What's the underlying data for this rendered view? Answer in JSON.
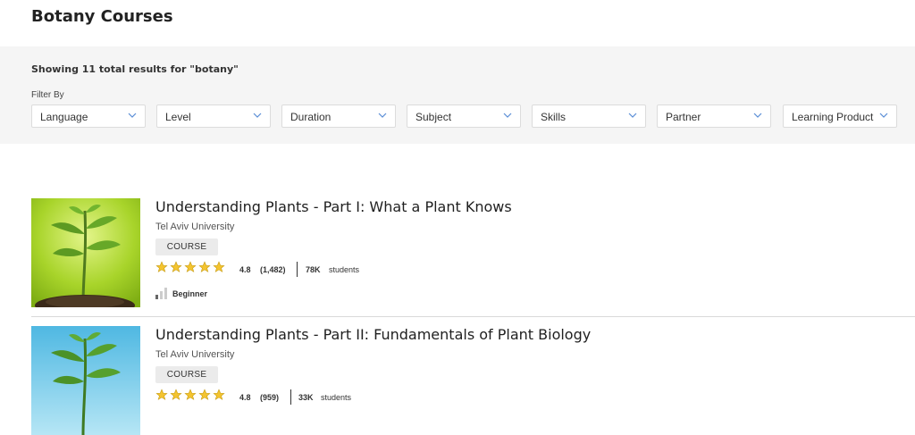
{
  "page": {
    "title": "Botany Courses"
  },
  "filters": {
    "results_text": "Showing 11 total results for \"botany\"",
    "filter_by_label": "Filter By",
    "dropdowns": [
      {
        "label": "Language"
      },
      {
        "label": "Level"
      },
      {
        "label": "Duration"
      },
      {
        "label": "Subject"
      },
      {
        "label": "Skills"
      },
      {
        "label": "Partner"
      },
      {
        "label": "Learning Product"
      }
    ]
  },
  "courses": [
    {
      "title": "Understanding Plants - Part I: What a Plant Knows",
      "partner": "Tel Aviv University",
      "type_badge": "COURSE",
      "rating": "4.8",
      "reviews": "(1,482)",
      "students_count": "78K",
      "students_label": "students",
      "level": "Beginner",
      "stars": 5,
      "thumb_colors": {
        "top": "#bde048",
        "bottom": "#8cbc1a",
        "plant": "#4f8a1e"
      },
      "level-icon": "signal-bars-icon"
    },
    {
      "title": "Understanding Plants - Part II: Fundamentals of Plant Biology",
      "partner": "Tel Aviv University",
      "type_badge": "COURSE",
      "rating": "4.8",
      "reviews": "(959)",
      "students_count": "33K",
      "students_label": "students",
      "stars": 5,
      "thumb_colors": {
        "top": "#5fc2e6",
        "bottom": "#a8e0f2",
        "plant": "#3e8f2c"
      }
    }
  ],
  "icons": {
    "dropdown": "chevron-down-icon",
    "rating": "star-icon"
  },
  "colors": {
    "star_fill": "#f4c430",
    "star_stroke": "#c59a10",
    "chevron": "#5a8dd6",
    "panel_bg": "#f5f5f5"
  }
}
